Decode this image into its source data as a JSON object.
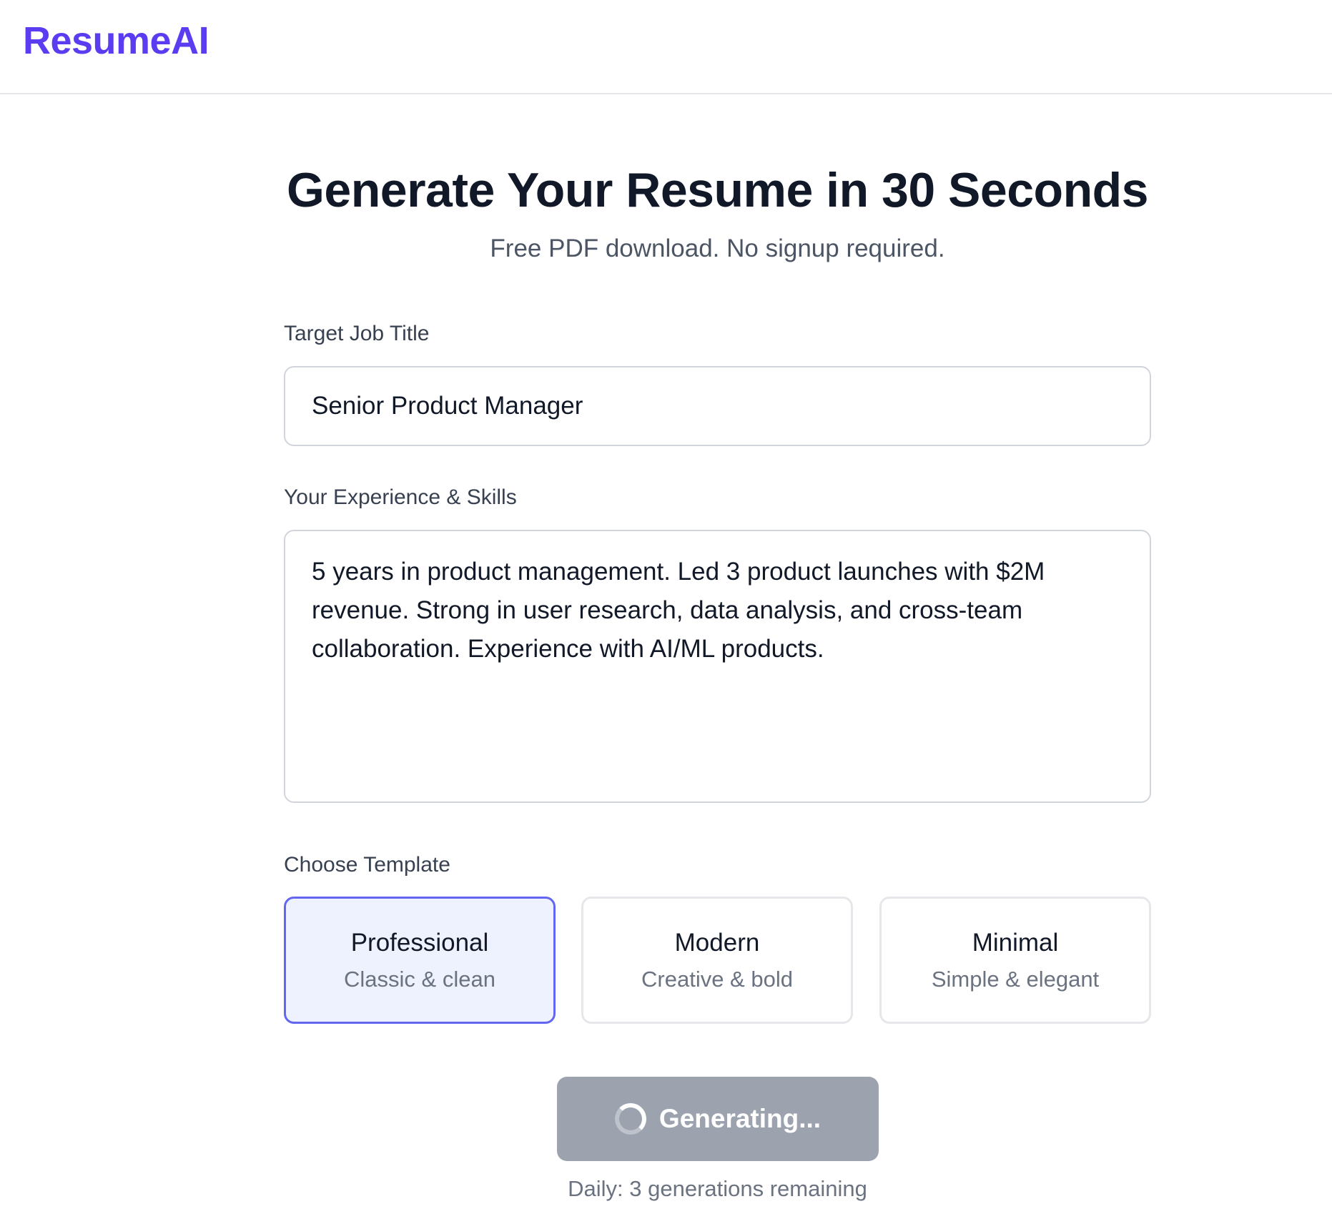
{
  "app": {
    "logo": "ResumeAI"
  },
  "hero": {
    "title": "Generate Your Resume in 30 Seconds",
    "subtitle": "Free PDF download. No signup required."
  },
  "form": {
    "job_title_label": "Target Job Title",
    "job_title_value": "Senior Product Manager",
    "experience_label": "Your Experience & Skills",
    "experience_value": "5 years in product management. Led 3 product launches with $2M revenue. Strong in user research, data analysis, and cross-team collaboration. Experience with AI/ML products.",
    "template_label": "Choose Template",
    "templates": [
      {
        "name": "Professional",
        "description": "Classic & clean",
        "selected": true
      },
      {
        "name": "Modern",
        "description": "Creative & bold",
        "selected": false
      },
      {
        "name": "Minimal",
        "description": "Simple & elegant",
        "selected": false
      }
    ],
    "submit_label": "Generating...",
    "submit_state": "loading",
    "submit_icon": "spinner-icon",
    "daily_limit_text": "Daily: 3 generations remaining"
  },
  "colors": {
    "brand": "#5b3cf0",
    "selected_border": "#6366f1",
    "selected_bg": "#eef2ff",
    "button_disabled": "#9ca3af"
  }
}
